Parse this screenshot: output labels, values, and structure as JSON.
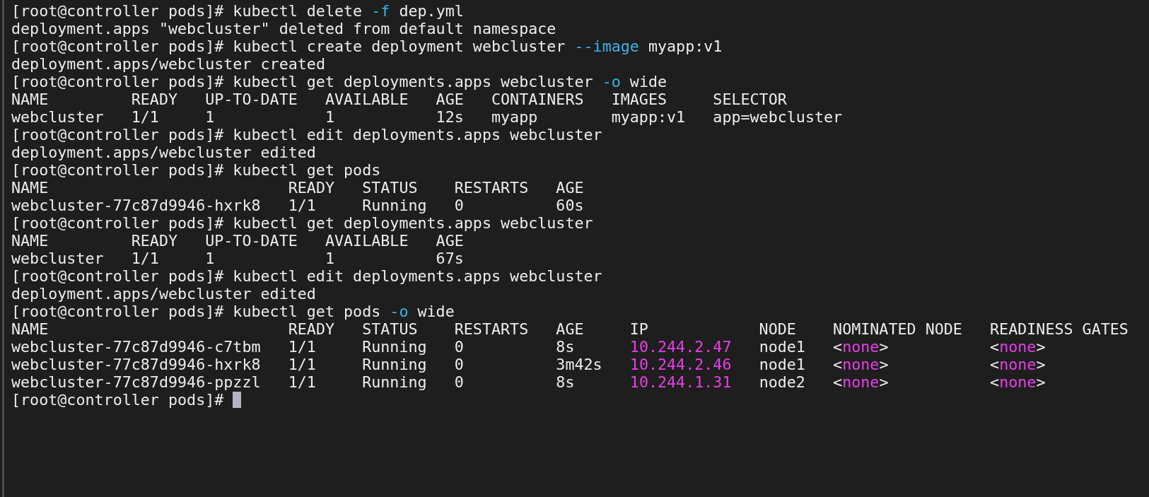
{
  "terminal": {
    "lines": [
      {
        "kind": "command",
        "prompt": "[root@controller pods]#",
        "cursor": false,
        "parts": [
          {
            "kind": "plain",
            "text": "kubectl delete "
          },
          {
            "kind": "flag",
            "text": "-f"
          },
          {
            "kind": "plain",
            "text": " dep.yml"
          }
        ]
      },
      {
        "kind": "output",
        "parts": [
          {
            "kind": "plain",
            "text": "deployment.apps \"webcluster\" deleted from default namespace"
          }
        ]
      },
      {
        "kind": "command",
        "prompt": "[root@controller pods]#",
        "cursor": false,
        "parts": [
          {
            "kind": "plain",
            "text": "kubectl create deployment webcluster "
          },
          {
            "kind": "flag",
            "text": "--image"
          },
          {
            "kind": "plain",
            "text": " myapp:v1"
          }
        ]
      },
      {
        "kind": "output",
        "parts": [
          {
            "kind": "plain",
            "text": "deployment.apps/webcluster created"
          }
        ]
      },
      {
        "kind": "command",
        "prompt": "[root@controller pods]#",
        "cursor": false,
        "parts": [
          {
            "kind": "plain",
            "text": "kubectl get deployments.apps webcluster "
          },
          {
            "kind": "flag",
            "text": "-o"
          },
          {
            "kind": "plain",
            "text": " wide"
          }
        ]
      },
      {
        "kind": "output",
        "parts": [
          {
            "kind": "plain",
            "text": "NAME         READY   UP-TO-DATE   AVAILABLE   AGE   CONTAINERS   IMAGES     SELECTOR"
          }
        ]
      },
      {
        "kind": "output",
        "parts": [
          {
            "kind": "plain",
            "text": "webcluster   1/1     1            1           12s   myapp        myapp:v1   app=webcluster"
          }
        ]
      },
      {
        "kind": "command",
        "prompt": "[root@controller pods]#",
        "cursor": false,
        "parts": [
          {
            "kind": "plain",
            "text": "kubectl edit deployments.apps webcluster"
          }
        ]
      },
      {
        "kind": "output",
        "parts": [
          {
            "kind": "plain",
            "text": "deployment.apps/webcluster edited"
          }
        ]
      },
      {
        "kind": "command",
        "prompt": "[root@controller pods]#",
        "cursor": false,
        "parts": [
          {
            "kind": "plain",
            "text": "kubectl get pods"
          }
        ]
      },
      {
        "kind": "output",
        "parts": [
          {
            "kind": "plain",
            "text": "NAME                          READY   STATUS    RESTARTS   AGE"
          }
        ]
      },
      {
        "kind": "output",
        "parts": [
          {
            "kind": "plain",
            "text": "webcluster-77c87d9946-hxrk8   1/1     Running   0          60s"
          }
        ]
      },
      {
        "kind": "command",
        "prompt": "[root@controller pods]#",
        "cursor": false,
        "parts": [
          {
            "kind": "plain",
            "text": "kubectl get deployments.apps webcluster"
          }
        ]
      },
      {
        "kind": "output",
        "parts": [
          {
            "kind": "plain",
            "text": "NAME         READY   UP-TO-DATE   AVAILABLE   AGE"
          }
        ]
      },
      {
        "kind": "output",
        "parts": [
          {
            "kind": "plain",
            "text": "webcluster   1/1     1            1           67s"
          }
        ]
      },
      {
        "kind": "command",
        "prompt": "[root@controller pods]#",
        "cursor": false,
        "parts": [
          {
            "kind": "plain",
            "text": "kubectl edit deployments.apps webcluster"
          }
        ]
      },
      {
        "kind": "output",
        "parts": [
          {
            "kind": "plain",
            "text": "deployment.apps/webcluster edited"
          }
        ]
      },
      {
        "kind": "command",
        "prompt": "[root@controller pods]#",
        "cursor": false,
        "parts": [
          {
            "kind": "plain",
            "text": "kubectl get pods "
          },
          {
            "kind": "flag",
            "text": "-o"
          },
          {
            "kind": "plain",
            "text": " wide"
          }
        ]
      },
      {
        "kind": "output",
        "parts": [
          {
            "kind": "plain",
            "text": "NAME                          READY   STATUS    RESTARTS   AGE     IP            NODE    NOMINATED NODE   READINESS GATES"
          }
        ]
      },
      {
        "kind": "output",
        "parts": [
          {
            "kind": "plain",
            "text": "webcluster-77c87d9946-c7tbm   1/1     Running   0          8s      "
          },
          {
            "kind": "value",
            "text": "10.244.2.47"
          },
          {
            "kind": "plain",
            "text": "   node1   <"
          },
          {
            "kind": "value",
            "text": "none"
          },
          {
            "kind": "plain",
            "text": ">           <"
          },
          {
            "kind": "value",
            "text": "none"
          },
          {
            "kind": "plain",
            "text": ">"
          }
        ]
      },
      {
        "kind": "output",
        "parts": [
          {
            "kind": "plain",
            "text": "webcluster-77c87d9946-hxrk8   1/1     Running   0          3m42s   "
          },
          {
            "kind": "value",
            "text": "10.244.2.46"
          },
          {
            "kind": "plain",
            "text": "   node1   <"
          },
          {
            "kind": "value",
            "text": "none"
          },
          {
            "kind": "plain",
            "text": ">           <"
          },
          {
            "kind": "value",
            "text": "none"
          },
          {
            "kind": "plain",
            "text": ">"
          }
        ]
      },
      {
        "kind": "output",
        "parts": [
          {
            "kind": "plain",
            "text": "webcluster-77c87d9946-ppzzl   1/1     Running   0          8s      "
          },
          {
            "kind": "value",
            "text": "10.244.1.31"
          },
          {
            "kind": "plain",
            "text": "   node2   <"
          },
          {
            "kind": "value",
            "text": "none"
          },
          {
            "kind": "plain",
            "text": ">           <"
          },
          {
            "kind": "value",
            "text": "none"
          },
          {
            "kind": "plain",
            "text": ">"
          }
        ]
      },
      {
        "kind": "command",
        "prompt": "[root@controller pods]#",
        "cursor": true
      }
    ]
  }
}
